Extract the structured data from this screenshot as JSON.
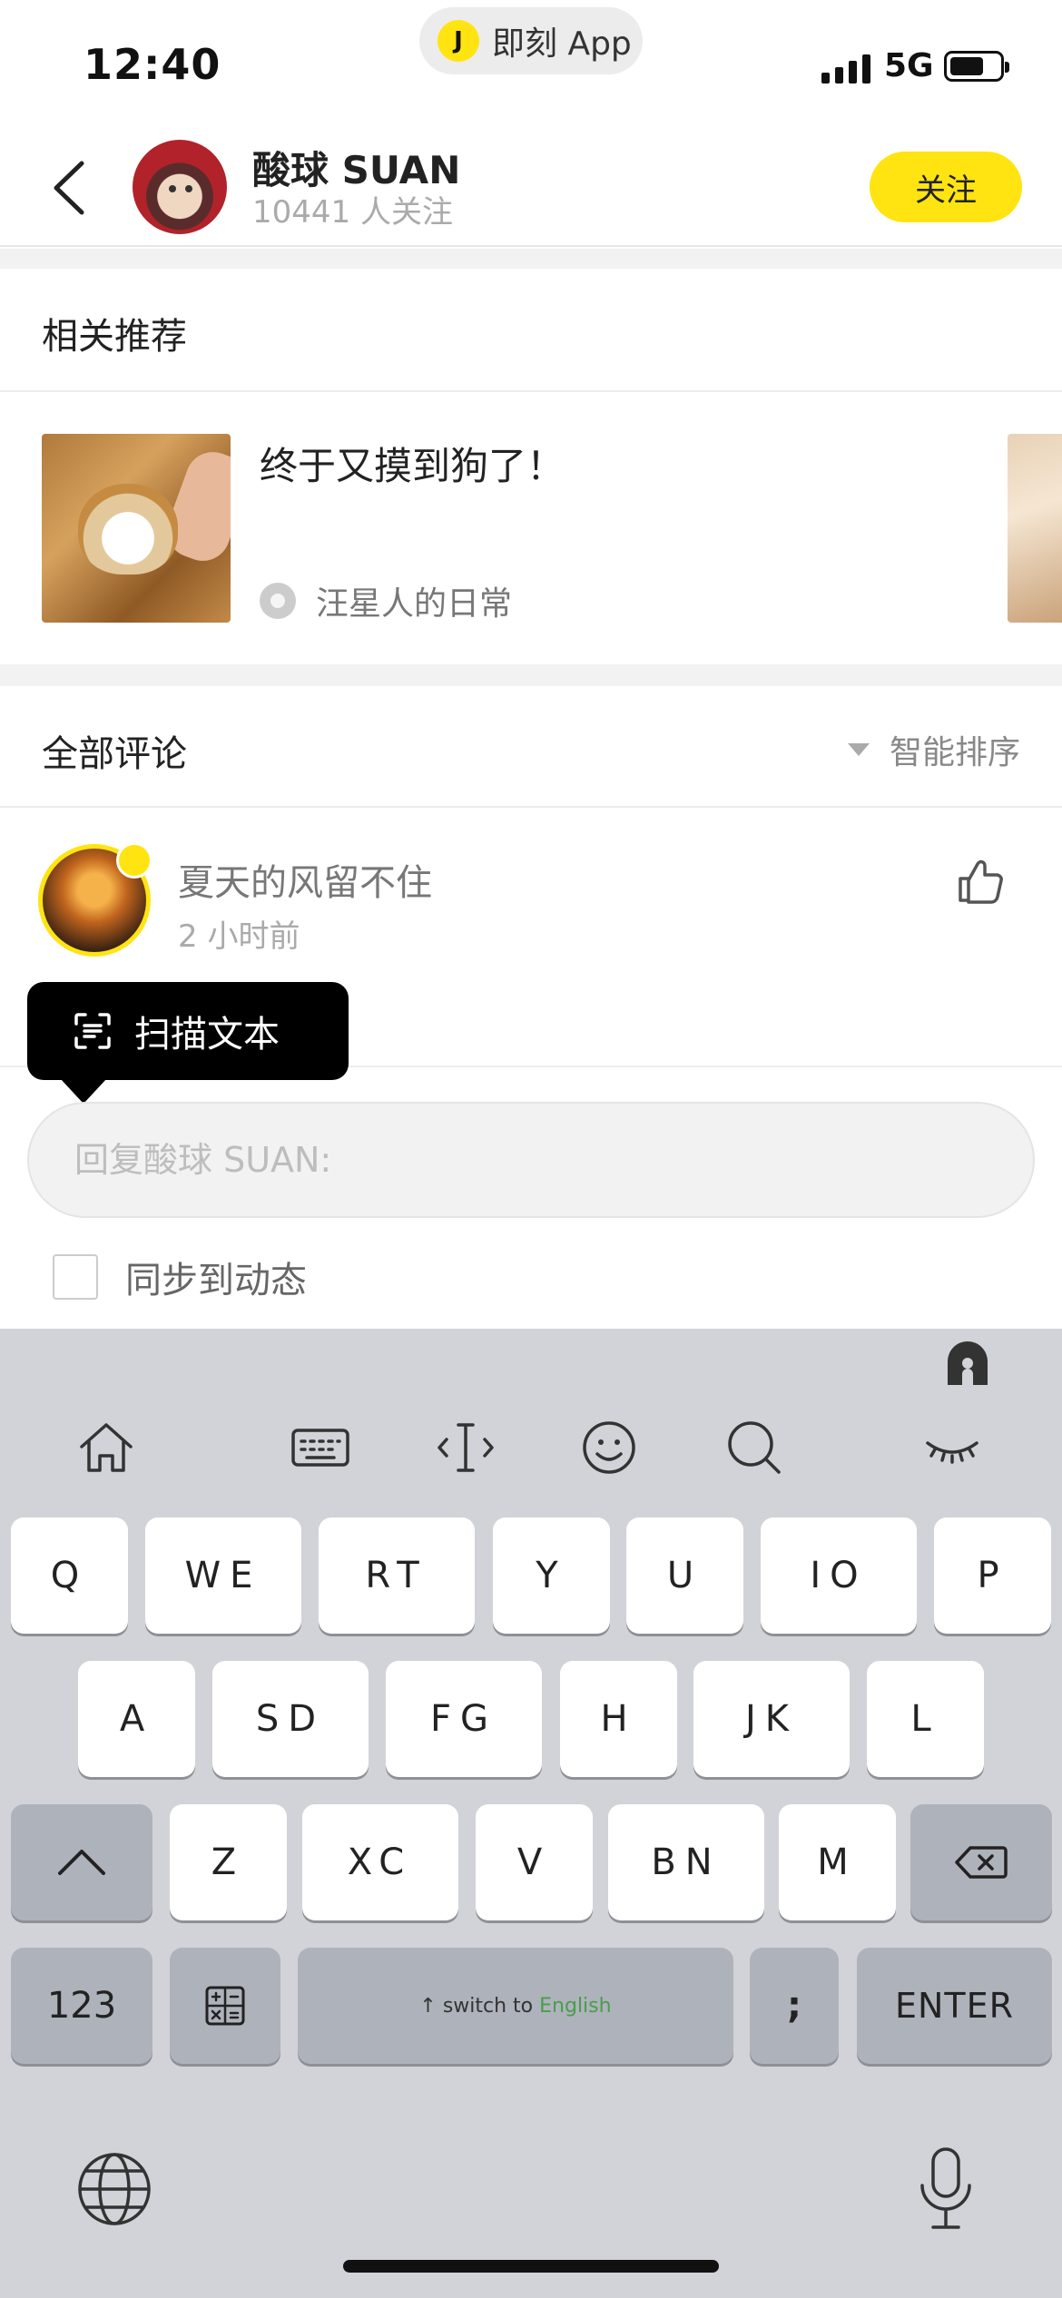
{
  "status_bar": {
    "time": "12:40",
    "app_pill_logo": "J",
    "app_pill_label": "即刻 App",
    "network": "5G"
  },
  "header": {
    "name": "酸球 SUAN",
    "followers": "10441 人关注",
    "follow_label": "关注",
    "accent_color": "#FFE411"
  },
  "related": {
    "title": "相关推荐",
    "items": [
      {
        "title": "终于又摸到狗了！",
        "topic": "汪星人的日常"
      }
    ]
  },
  "comments": {
    "title": "全部评论",
    "sort_label": "智能排序",
    "items": [
      {
        "user": "夏天的风留不住",
        "time": "2 小时前"
      }
    ]
  },
  "tooltip": {
    "label": "扫描文本"
  },
  "reply": {
    "placeholder": "回复酸球 SUAN:",
    "sync_label": "同步到动态"
  },
  "keyboard": {
    "row1": [
      "Q",
      "WE",
      "RT",
      "Y",
      "U",
      "IO",
      "P"
    ],
    "row2": [
      "A",
      "SD",
      "FG",
      "H",
      "JK",
      "L"
    ],
    "row3": [
      "Z",
      "XC",
      "V",
      "BN",
      "M"
    ],
    "numbers_label": "123",
    "space_prefix": "↑ switch to ",
    "space_lang": "English",
    "semicolon": ";",
    "enter_label": "ENTER"
  }
}
